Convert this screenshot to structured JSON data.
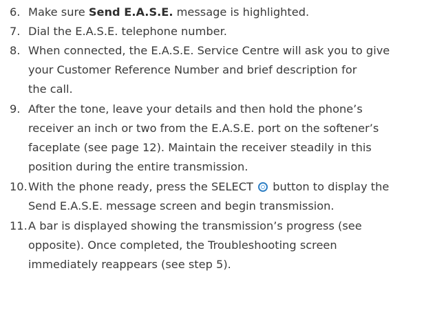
{
  "steps": [
    {
      "number": "6.",
      "lines": [
        {
          "before": "Make sure ",
          "bold": "Send E.A.S.E.",
          "after": " message is highlighted."
        }
      ]
    },
    {
      "number": "7.",
      "lines": [
        "Dial the E.A.S.E. telephone number."
      ]
    },
    {
      "number": "8.",
      "lines": [
        "When connected, the E.A.S.E. Service Centre will ask you to give",
        "your Customer Reference Number and brief description for",
        "the call."
      ]
    },
    {
      "number": "9.",
      "lines": [
        "After the tone, leave your details and then hold the phone’s",
        "receiver an inch or two from the E.A.S.E. port on the softener’s",
        "faceplate (see page 12). Maintain the receiver steadily in this",
        "position during the entire transmission."
      ]
    },
    {
      "number": "10.",
      "lines": [
        {
          "before": "With the phone ready, press the SELECT ",
          "icon": "select-button-icon",
          "after": " button to display the"
        },
        "Send E.A.S.E. message screen and begin transmission."
      ]
    },
    {
      "number": "11.",
      "lines": [
        "A bar is displayed showing the transmission’s progress (see",
        "opposite). Once completed, the Troubleshooting screen",
        "immediately reappears (see step 5)."
      ]
    }
  ]
}
